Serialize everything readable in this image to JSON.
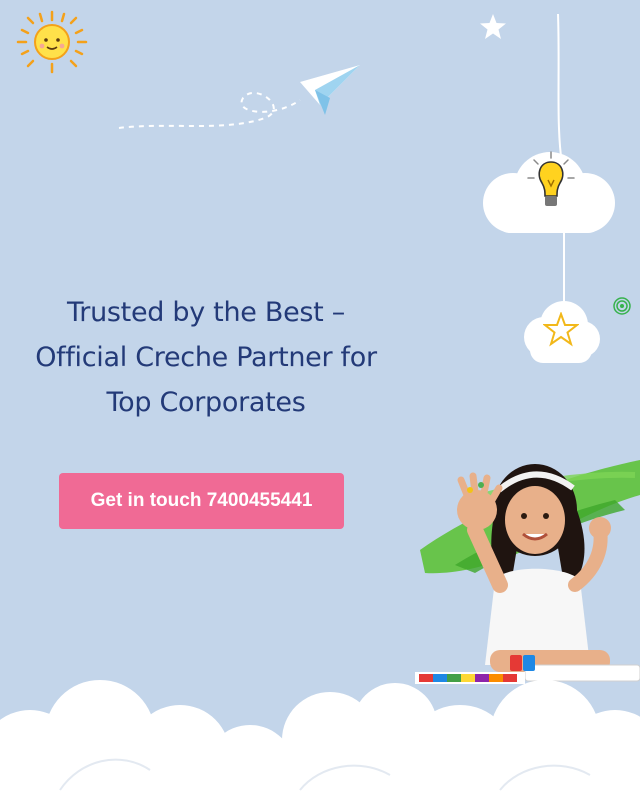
{
  "hero": {
    "headline_lines": [
      "Trusted by the Best –",
      "Official Creche Partner for",
      "Top Corporates"
    ],
    "cta_label": "Get in touch 7400455441"
  },
  "colors": {
    "background": "#c3d5ea",
    "headline": "#233a78",
    "cta_background": "#f06a95",
    "cta_text": "#ffffff"
  },
  "icons": {
    "sun": "sun-icon",
    "star": "star-icon",
    "paper_plane": "paper-plane-icon",
    "bulb": "lightbulb-icon",
    "spiral": "spiral-icon"
  }
}
